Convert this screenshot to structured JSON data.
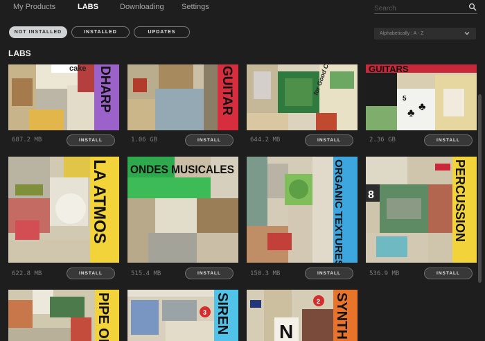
{
  "nav": {
    "tabs": [
      {
        "label": "My Products"
      },
      {
        "label": "LABS"
      },
      {
        "label": "Downloading"
      },
      {
        "label": "Settings"
      }
    ]
  },
  "search": {
    "placeholder": "Search",
    "icon": "search-icon"
  },
  "filters": [
    {
      "label": "NOT INSTALLED"
    },
    {
      "label": "INSTALLED"
    },
    {
      "label": "UPDATES"
    }
  ],
  "sort": {
    "label": "Alphabetically : A - Z",
    "icon": "chevron-down-icon"
  },
  "section": {
    "title": "LABS"
  },
  "products": [
    {
      "art_text": "DHARP",
      "extra_text": "cake",
      "size": "687.2 MB",
      "button": "INSTALL",
      "accent": "#9b63c9"
    },
    {
      "art_text": "GUITAR",
      "extra_text": "",
      "size": "1.06 GB",
      "button": "INSTALL",
      "accent": "#c9283a"
    },
    {
      "art_text": "",
      "extra_text": "for Good Chocolate",
      "size": "644.2 MB",
      "button": "INSTALL",
      "accent": "#2f7a3e"
    },
    {
      "art_text": "GUITARS",
      "extra_text": "",
      "size": "2.36 GB",
      "button": "INSTALL",
      "accent": "#c9283a"
    },
    {
      "art_text": "LA ATMOS",
      "extra_text": "",
      "size": "622.8 MB",
      "button": "INSTALL",
      "accent": "#f2d43a"
    },
    {
      "art_text": "ONDES MUSICALES",
      "extra_text": "",
      "size": "515.4 MB",
      "button": "INSTALL",
      "accent": "#3dbb56"
    },
    {
      "art_text": "ORGANIC TEXTURES",
      "extra_text": "",
      "size": "150.3 MB",
      "button": "INSTALL",
      "accent": "#3ea6de"
    },
    {
      "art_text": "PERCUSSION",
      "extra_text": "",
      "size": "536.9 MB",
      "button": "INSTALL",
      "accent": "#f2d43a"
    },
    {
      "art_text": "PIPE OR",
      "extra_text": "",
      "accent": "#f2d43a"
    },
    {
      "art_text": "SIREN",
      "extra_text": "",
      "accent": "#52c3e8"
    },
    {
      "art_text": "SYNTH",
      "extra_text": "N",
      "accent": "#e8742b"
    }
  ]
}
